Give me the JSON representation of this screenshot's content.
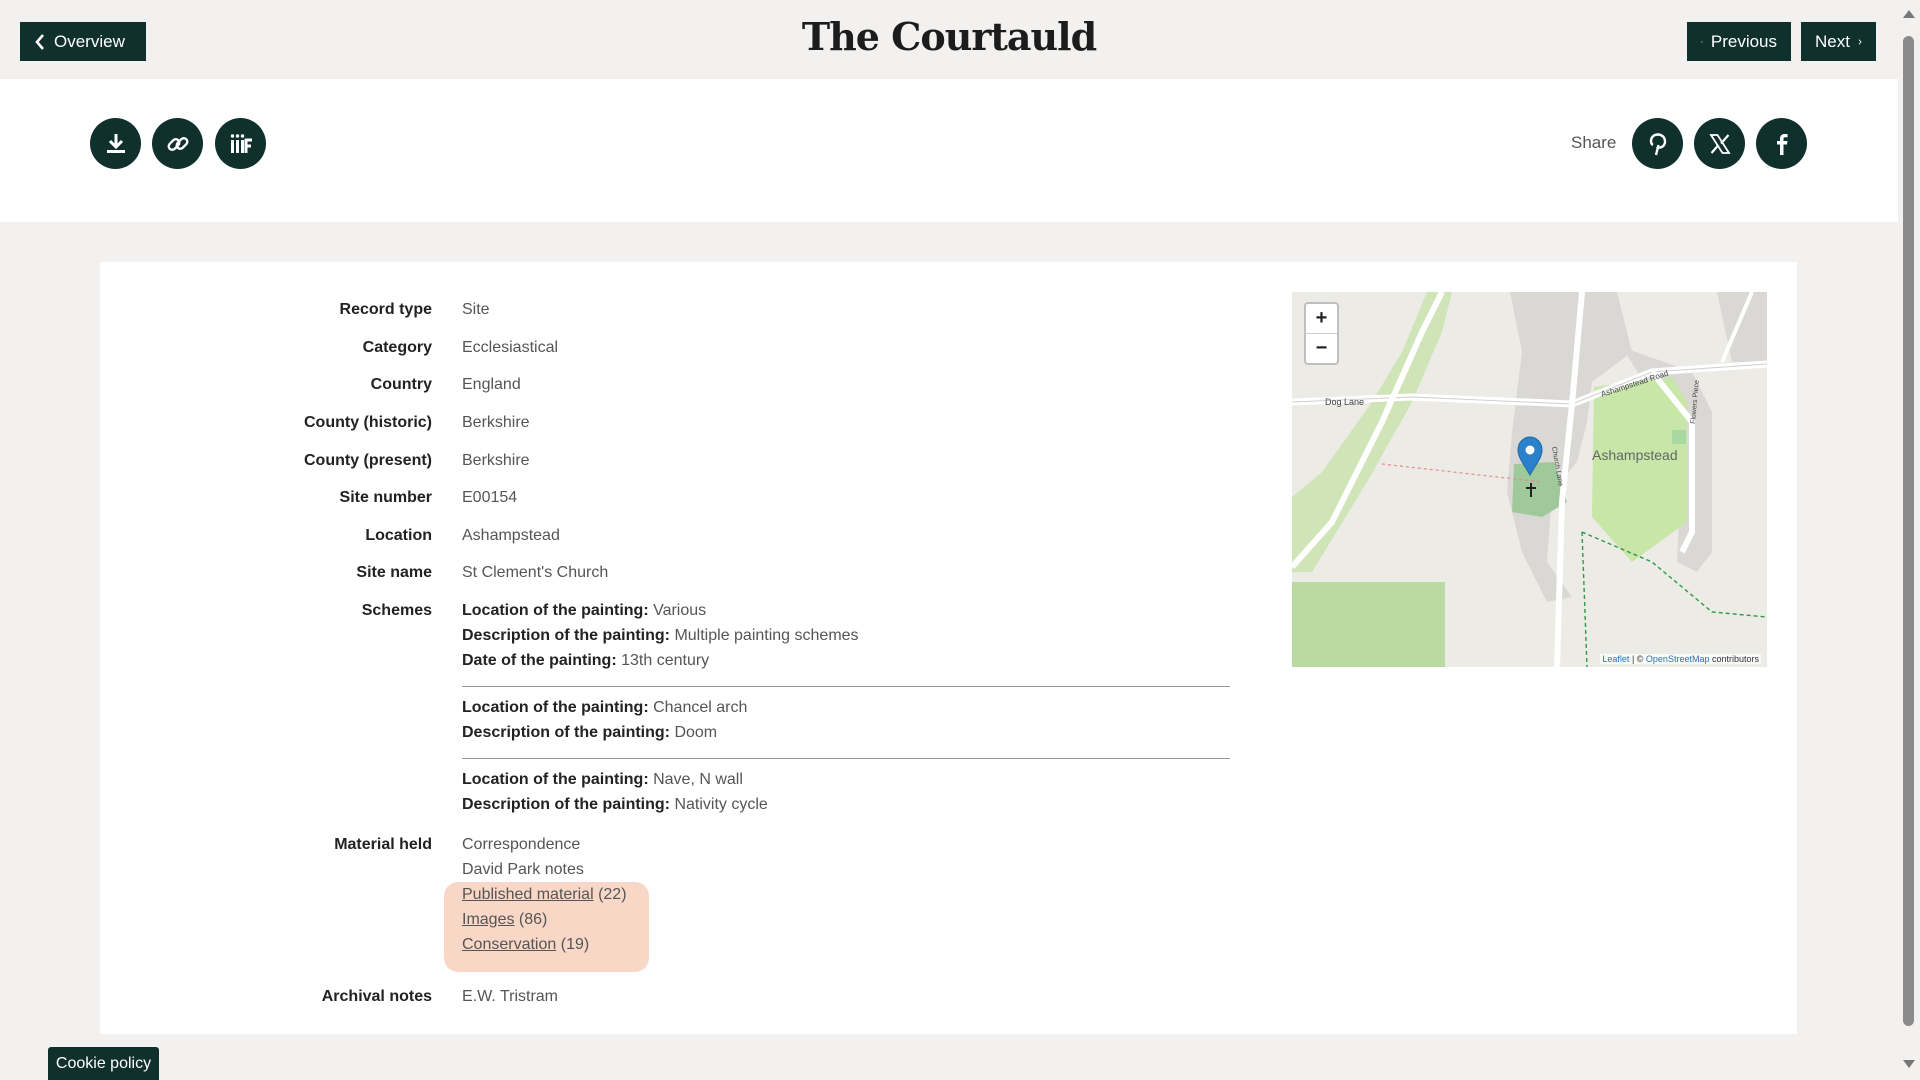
{
  "header": {
    "logo_text": "The Courtauld",
    "overview_label": "Overview",
    "previous_label": "Previous",
    "next_label": "Next"
  },
  "toolbar": {
    "share_label": "Share",
    "icons": [
      "download-icon",
      "link-icon",
      "iiif-icon",
      "pinterest-icon",
      "x-icon",
      "facebook-icon"
    ]
  },
  "record": {
    "record_type": {
      "label": "Record type",
      "value": "Site"
    },
    "category": {
      "label": "Category",
      "value": "Ecclesiastical"
    },
    "country": {
      "label": "Country",
      "value": "England"
    },
    "county_historic": {
      "label": "County (historic)",
      "value": "Berkshire"
    },
    "county_present": {
      "label": "County (present)",
      "value": "Berkshire"
    },
    "site_number": {
      "label": "Site number",
      "value": "E00154"
    },
    "location": {
      "label": "Location",
      "value": "Ashampstead"
    },
    "site_name": {
      "label": "Site name",
      "value": "St Clement's Church"
    },
    "schemes_label": "Schemes",
    "schemes": [
      {
        "loc_label": "Location of the painting:",
        "loc": "Various",
        "desc_label": "Description of the painting:",
        "desc": "Multiple painting schemes",
        "date_label": "Date of the painting:",
        "date": "13th century"
      },
      {
        "loc_label": "Location of the painting:",
        "loc": "Chancel arch",
        "desc_label": "Description of the painting:",
        "desc": "Doom"
      },
      {
        "loc_label": "Location of the painting:",
        "loc": "Nave, N wall",
        "desc_label": "Description of the painting:",
        "desc": "Nativity cycle"
      }
    ],
    "material_label": "Material held",
    "material": {
      "correspondence": "Correspondence",
      "park_notes": "David Park notes",
      "published_link": "Published material",
      "published_count": "(22)",
      "images_link": "Images",
      "images_count": "(86)",
      "conservation_link": "Conservation",
      "conservation_count": "(19)"
    },
    "archival_label": "Archival notes",
    "archival_value": "E.W. Tristram"
  },
  "map": {
    "zoom_in": "+",
    "zoom_out": "−",
    "labels": {
      "dog_lane": "Dog Lane",
      "ashampstead_road": "Ashampstead Road",
      "church_lane": "Church Lane",
      "flowers_piece": "Flowers Piece",
      "place": "Ashampstead"
    },
    "attribution_leaflet": "Leaflet",
    "attribution_sep": " | © ",
    "attribution_osm": "OpenStreetMap",
    "attribution_tail": " contributors",
    "marker_color": "#2a81cb"
  },
  "footer": {
    "cookie_label": "Cookie policy"
  },
  "colors": {
    "brand": "#10302d",
    "highlight": "#f9d7c7"
  }
}
